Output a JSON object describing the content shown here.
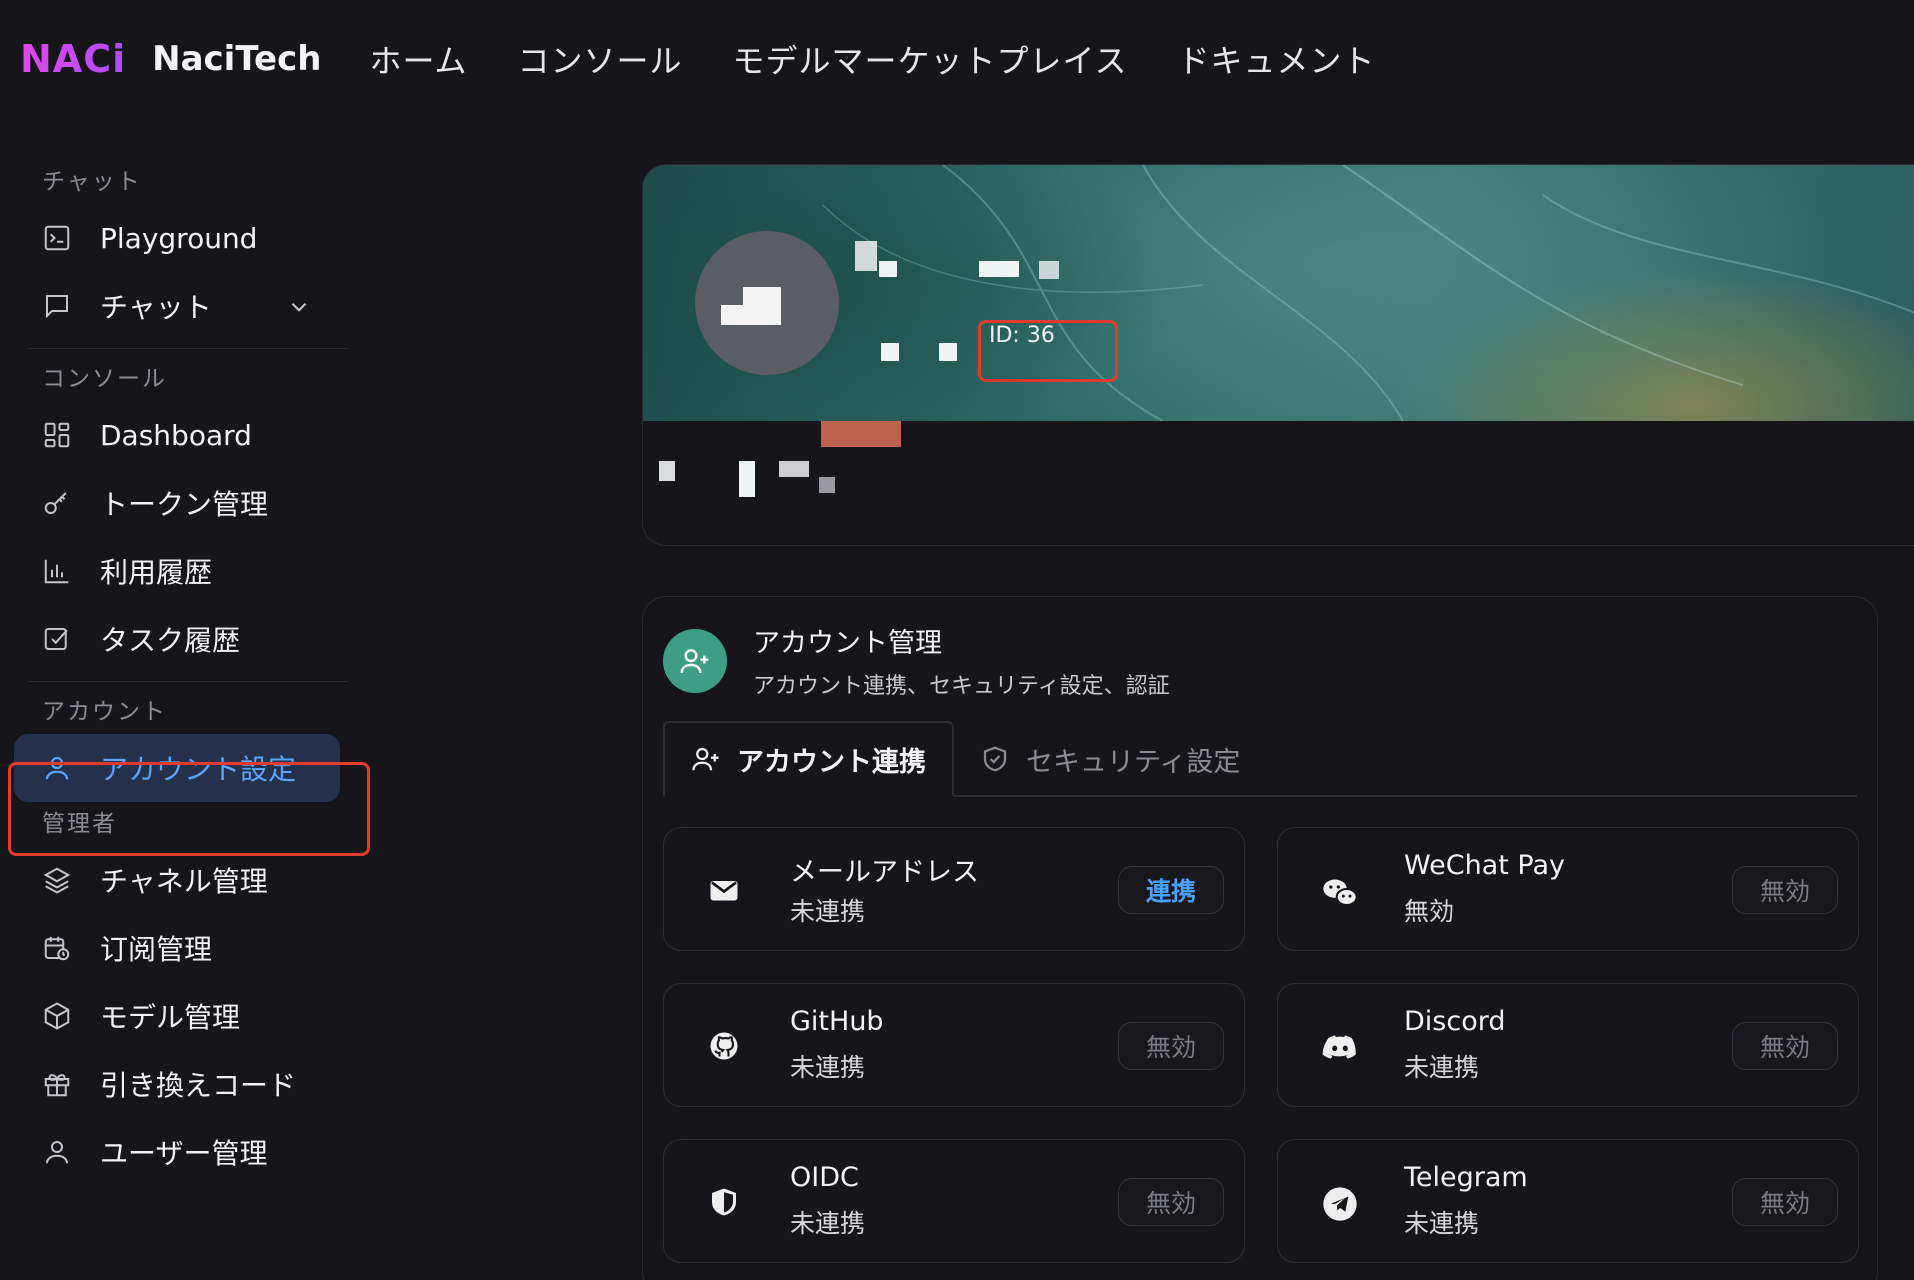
{
  "header": {
    "logo": "NACi",
    "brand": "NaciTech",
    "nav": [
      "ホーム",
      "コンソール",
      "モデルマーケットプレイス",
      "ドキュメント"
    ]
  },
  "sidebar": {
    "sections": {
      "chat": "チャット",
      "console": "コンソール",
      "account": "アカウント",
      "admin": "管理者"
    },
    "items": {
      "playground": "Playground",
      "chat": "チャット",
      "dashboard": "Dashboard",
      "tokens": "トークン管理",
      "usage": "利用履歴",
      "tasks": "タスク履歴",
      "account_settings": "アカウント設定",
      "channels": "チャネル管理",
      "subscriptions": "订阅管理",
      "models": "モデル管理",
      "redeem": "引き換えコード",
      "users": "ユーザー管理"
    }
  },
  "profile": {
    "id_label": "ID: 36"
  },
  "account_management": {
    "title": "アカウント管理",
    "subtitle": "アカウント連携、セキュリティ設定、認証",
    "tabs": [
      "アカウント連携",
      "セキュリティ設定"
    ],
    "bindings": [
      {
        "name": "メールアドレス",
        "status": "未連携",
        "button": "連携",
        "icon": "mail-icon",
        "enabled": true
      },
      {
        "name": "WeChat Pay",
        "status": "無効",
        "button": "無効",
        "icon": "wechat-icon",
        "enabled": false
      },
      {
        "name": "GitHub",
        "status": "未連携",
        "button": "無効",
        "icon": "github-icon",
        "enabled": false
      },
      {
        "name": "Discord",
        "status": "未連携",
        "button": "無効",
        "icon": "discord-icon",
        "enabled": false
      },
      {
        "name": "OIDC",
        "status": "未連携",
        "button": "無効",
        "icon": "oidc-shield-icon",
        "enabled": false
      },
      {
        "name": "Telegram",
        "status": "未連携",
        "button": "無効",
        "icon": "telegram-icon",
        "enabled": false
      }
    ]
  },
  "colors": {
    "background": "#16161a",
    "accent_blue": "#5aa3ff",
    "highlight_red": "#e23b2e",
    "teal": "#3e9e84"
  }
}
